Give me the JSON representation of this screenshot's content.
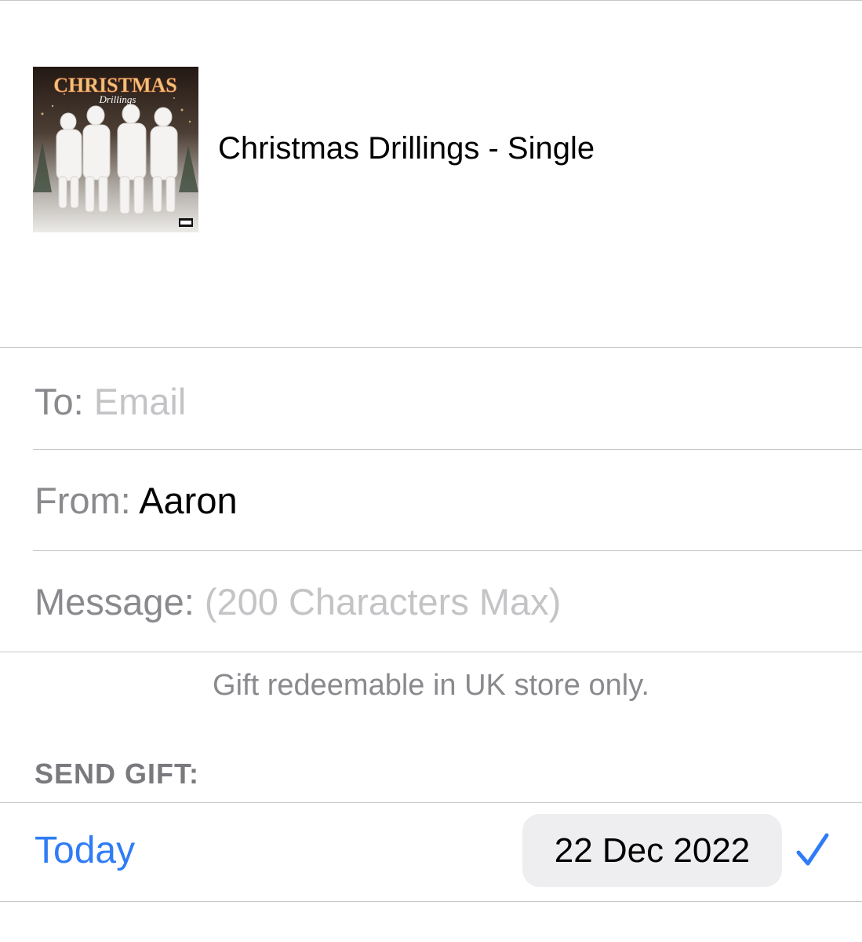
{
  "album": {
    "art_title": "CHRISTMAS",
    "art_subtitle": "Drillings",
    "title": "Christmas Drillings - Single"
  },
  "form": {
    "to_label": "To:",
    "to_placeholder": "Email",
    "from_label": "From:",
    "from_value": "Aaron",
    "message_label": "Message:",
    "message_placeholder": "(200 Characters Max)"
  },
  "note": "Gift redeemable in UK store only.",
  "send_gift": {
    "header": "SEND GIFT:",
    "today_label": "Today",
    "date_value": "22 Dec 2022",
    "selected": true,
    "check_icon": "checkmark-icon"
  },
  "colors": {
    "accent": "#2f7cf6",
    "label": "#8a8a8e",
    "placeholder": "#c4c4c7",
    "separator": "#c6c6c8",
    "pill": "#eeeef0"
  }
}
